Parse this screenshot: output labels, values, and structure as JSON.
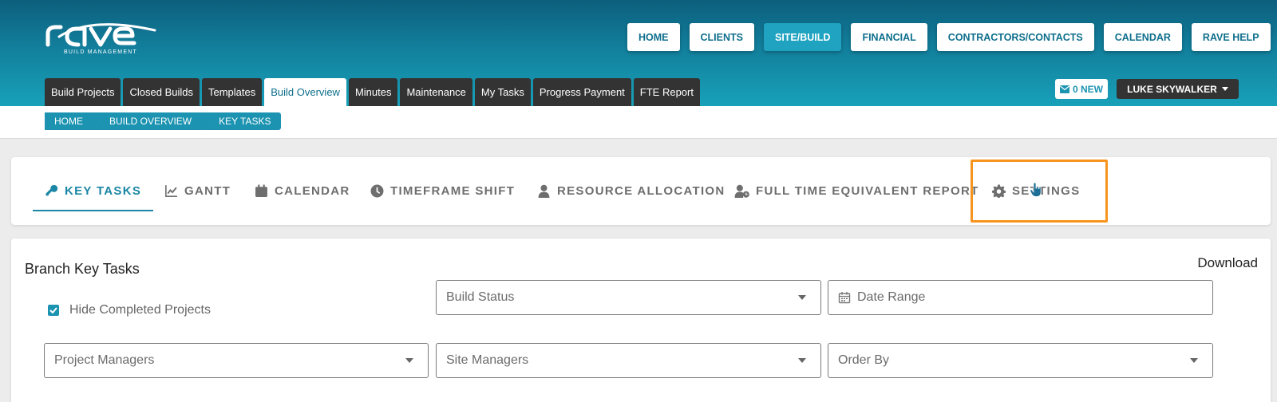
{
  "brand": {
    "logo_text": "rave",
    "subtitle": "BUILD MANAGEMENT"
  },
  "topnav": [
    {
      "label": "HOME",
      "active": false
    },
    {
      "label": "CLIENTS",
      "active": false
    },
    {
      "label": "SITE/BUILD",
      "active": true
    },
    {
      "label": "FINANCIAL",
      "active": false
    },
    {
      "label": "CONTRACTORS/CONTACTS",
      "active": false
    },
    {
      "label": "CALENDAR",
      "active": false
    },
    {
      "label": "RAVE HELP",
      "active": false
    }
  ],
  "subtabs": [
    {
      "label": "Build Projects",
      "active": false
    },
    {
      "label": "Closed Builds",
      "active": false
    },
    {
      "label": "Templates",
      "active": false
    },
    {
      "label": "Build Overview",
      "active": true
    },
    {
      "label": "Minutes",
      "active": false
    },
    {
      "label": "Maintenance",
      "active": false
    },
    {
      "label": "My Tasks",
      "active": false
    },
    {
      "label": "Progress Payment",
      "active": false
    },
    {
      "label": "FTE Report",
      "active": false
    }
  ],
  "messages": {
    "label": "0 NEW",
    "icon": "envelope-icon"
  },
  "user": {
    "name": "LUKE SKYWALKER"
  },
  "breadcrumb": [
    "HOME",
    "BUILD OVERVIEW",
    "KEY TASKS"
  ],
  "feature_tabs": [
    {
      "label": "KEY TASKS",
      "icon": "key-icon",
      "active": true
    },
    {
      "label": "GANTT",
      "icon": "chart-line-icon",
      "active": false
    },
    {
      "label": "CALENDAR",
      "icon": "calendar-icon",
      "active": false
    },
    {
      "label": "TIMEFRAME SHIFT",
      "icon": "clock-icon",
      "active": false
    },
    {
      "label": "RESOURCE ALLOCATION",
      "icon": "user-icon",
      "active": false
    },
    {
      "label": "FULL TIME EQUIVALENT REPORT",
      "icon": "user-clock-icon",
      "active": false
    },
    {
      "label": "SETTINGS",
      "icon": "gear-icon",
      "active": false,
      "highlighted": true
    }
  ],
  "content": {
    "title": "Branch Key Tasks",
    "download_label": "Download",
    "hide_completed": {
      "label": "Hide Completed Projects",
      "checked": true
    },
    "filters": {
      "build_status": "Build Status",
      "date_range": "Date Range",
      "project_managers": "Project Managers",
      "site_managers": "Site Managers",
      "order_by": "Order By"
    }
  },
  "colors": {
    "accent": "#1b93b1",
    "highlight": "#f7941d",
    "dark_tab": "#333333"
  }
}
